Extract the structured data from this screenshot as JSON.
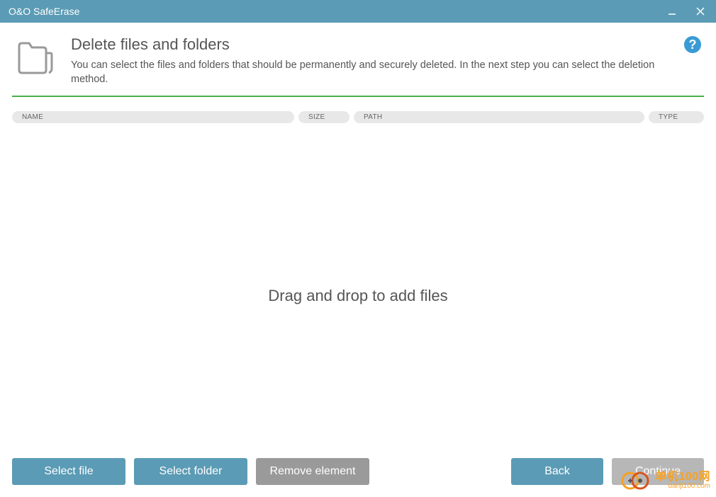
{
  "window": {
    "title": "O&O SafeErase"
  },
  "header": {
    "title": "Delete files and folders",
    "subtitle": "You can select the files and folders that should be permanently and securely deleted. In the next step you can select the deletion method."
  },
  "columns": {
    "name": "NAME",
    "size": "SIZE",
    "path": "PATH",
    "type": "TYPE"
  },
  "dropzone": {
    "text": "Drag and drop to add files"
  },
  "buttons": {
    "select_file": "Select file",
    "select_folder": "Select folder",
    "remove_element": "Remove element",
    "back": "Back",
    "continue": "Continue"
  },
  "watermark": {
    "main": "单机100网",
    "sub": "danji100.com"
  }
}
